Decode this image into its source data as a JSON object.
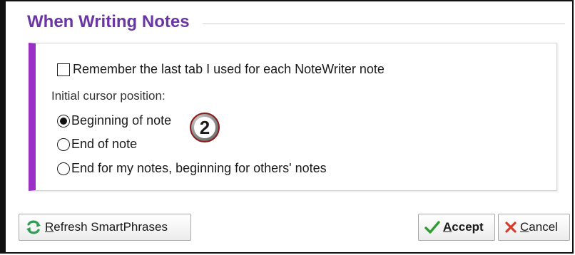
{
  "section": {
    "title": "When Writing Notes"
  },
  "options": {
    "remember_tab": {
      "label": "Remember the last tab I used for each NoteWriter note",
      "checked": false
    },
    "cursor_position": {
      "label": "Initial cursor position:",
      "choices": [
        {
          "label": "Beginning of note",
          "selected": true
        },
        {
          "label": "End of note",
          "selected": false
        },
        {
          "label": "End for my notes, beginning for others' notes",
          "selected": false
        }
      ]
    }
  },
  "annotation": {
    "step_number": "2"
  },
  "buttons": {
    "refresh": {
      "mnemonic": "R",
      "rest": "efresh SmartPhrases",
      "icon": "refresh-icon"
    },
    "accept": {
      "mnemonic": "A",
      "rest": "ccept",
      "icon": "checkmark-icon"
    },
    "cancel": {
      "mnemonic": "C",
      "rest": "ancel",
      "icon": "x-icon"
    }
  },
  "colors": {
    "title": "#6b36a4",
    "accent_bar": "#9b2fc6",
    "accept_check": "#2e9e2e",
    "cancel_x": "#d63b2a",
    "refresh_icon": "#2e9e55"
  }
}
